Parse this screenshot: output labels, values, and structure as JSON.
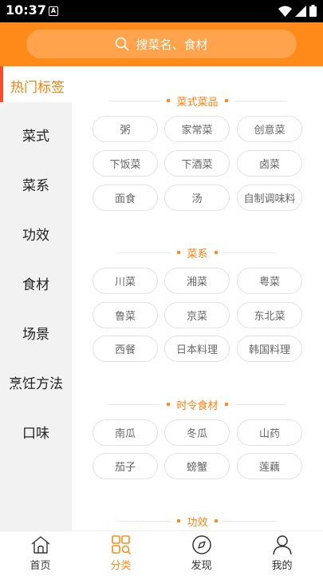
{
  "status_bar": {
    "time": "10:37",
    "notification_glyph": "A"
  },
  "header": {
    "search_placeholder": "搜菜名、食材"
  },
  "sidebar": {
    "hot_label": "热门标签",
    "items": [
      "菜式",
      "菜系",
      "功效",
      "食材",
      "场景",
      "烹饪方法",
      "口味"
    ]
  },
  "sections": [
    {
      "title": "菜式菜品",
      "tags": [
        "粥",
        "家常菜",
        "创意菜",
        "下饭菜",
        "下酒菜",
        "卤菜",
        "面食",
        "汤",
        "自制调味料"
      ]
    },
    {
      "title": "菜系",
      "tags": [
        "川菜",
        "湘菜",
        "粤菜",
        "鲁菜",
        "京菜",
        "东北菜",
        "西餐",
        "日本料理",
        "韩国料理"
      ]
    },
    {
      "title": "时令食材",
      "tags": [
        "南瓜",
        "冬瓜",
        "山药",
        "茄子",
        "螃蟹",
        "莲藕"
      ]
    },
    {
      "title": "功效",
      "tags": []
    }
  ],
  "tabbar": {
    "tabs": [
      {
        "label": "首页",
        "icon": "home-icon",
        "active": false
      },
      {
        "label": "分类",
        "icon": "category-icon",
        "active": true
      },
      {
        "label": "发现",
        "icon": "compass-icon",
        "active": false
      },
      {
        "label": "我的",
        "icon": "user-icon",
        "active": false
      }
    ]
  },
  "colors": {
    "accent": "#ff8a1a",
    "hot_bar": "#ff4b2b",
    "sidebar_bg": "#f2f2f2"
  }
}
